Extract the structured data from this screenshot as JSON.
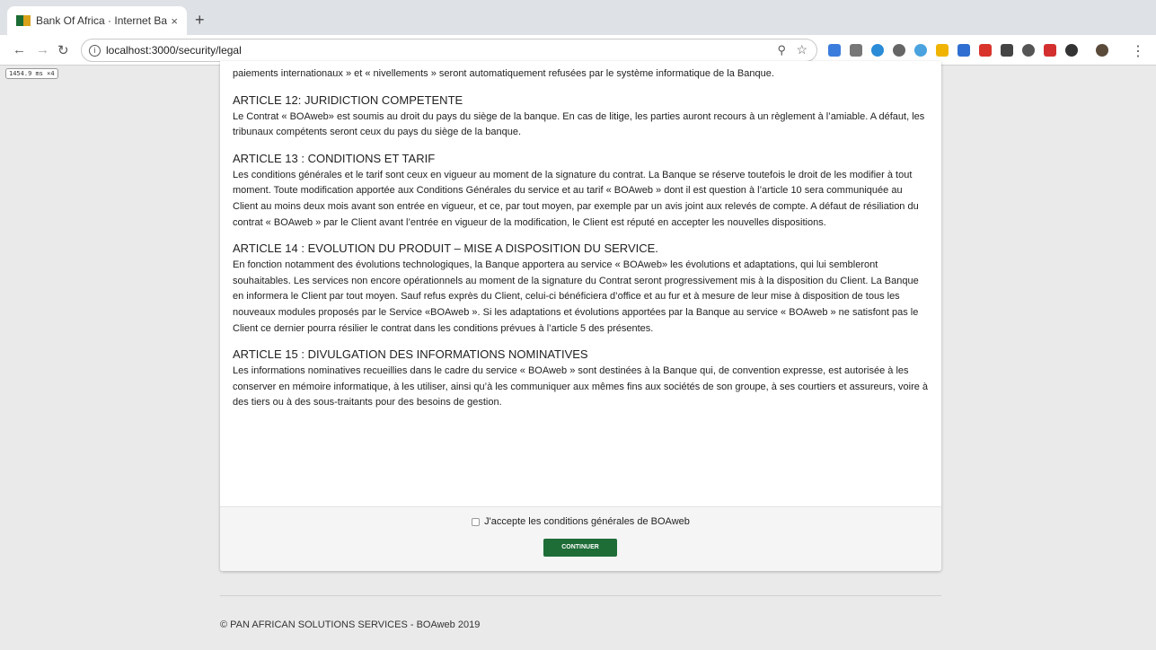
{
  "browser": {
    "tab_title": "Bank Of Africa · Internet Bankin",
    "tab_close": "×",
    "new_tab": "+",
    "url": "localhost:3000/security/legal",
    "dev_badge": "1454.9 ms ×4"
  },
  "legal": {
    "intro_tail": "paiements internationaux » et « nivellements » seront automatiquement refusées par le système informatique de la Banque.",
    "articles": [
      {
        "title": "ARTICLE 12: JURIDICTION COMPETENTE",
        "text": "Le Contrat « BOAweb» est soumis au droit du pays du siège de la banque. En cas de litige, les parties auront recours à un règlement à l’amiable. A défaut, les tribunaux compétents seront ceux du pays du siège de la banque."
      },
      {
        "title": "ARTICLE 13 : CONDITIONS ET TARIF",
        "text": "Les conditions générales et le tarif sont ceux en vigueur au moment de la signature du contrat. La Banque se réserve toutefois le droit de les modifier à tout moment. Toute modification apportée aux Conditions Générales du service et au tarif « BOAweb » dont il est question à l’article 10 sera communiquée au Client au moins deux mois avant son entrée en vigueur, et ce, par tout moyen, par exemple par un avis joint aux relevés de compte. A défaut de résiliation du contrat « BOAweb » par le Client avant l’entrée en vigueur de la modification, le Client est réputé en accepter les nouvelles dispositions."
      },
      {
        "title": "ARTICLE 14 : EVOLUTION DU PRODUIT – MISE A DISPOSITION DU SERVICE.",
        "text": "En fonction notamment des évolutions technologiques, la Banque apportera au service « BOAweb» les évolutions et adaptations, qui lui sembleront souhaitables. Les services non encore opérationnels au moment de la signature du Contrat seront progressivement mis à la disposition du Client. La Banque en informera le Client par tout moyen. Sauf refus exprès du Client, celui-ci bénéficiera d’office et au fur et à mesure de leur mise à disposition de tous les nouveaux modules proposés par le Service «BOAweb ». Si les adaptations et évolutions apportées par la Banque au service « BOAweb » ne satisfont pas le Client ce dernier pourra résilier le contrat dans les conditions prévues à l’article 5 des présentes."
      },
      {
        "title": "ARTICLE 15 : DIVULGATION DES INFORMATIONS NOMINATIVES",
        "text": "Les informations nominatives recueillies dans le cadre du service « BOAweb » sont destinées à la Banque qui, de convention expresse, est autorisée à les conserver en mémoire informatique, à les utiliser, ainsi qu’à les communiquer aux mêmes fins aux sociétés de son groupe, à ses courtiers et assureurs, voire à des tiers ou à des sous-traitants pour des besoins de gestion."
      }
    ]
  },
  "form": {
    "accept_label": "J'accepte les conditions générales de BOAweb",
    "accept_checked": false,
    "continue_label": "CONTINUER"
  },
  "footer": {
    "copyright": "© PAN AFRICAN SOLUTIONS SERVICES - BOAweb 2019"
  },
  "colors": {
    "brand_green": "#1e6d37",
    "page_bg": "#eaeaea"
  }
}
